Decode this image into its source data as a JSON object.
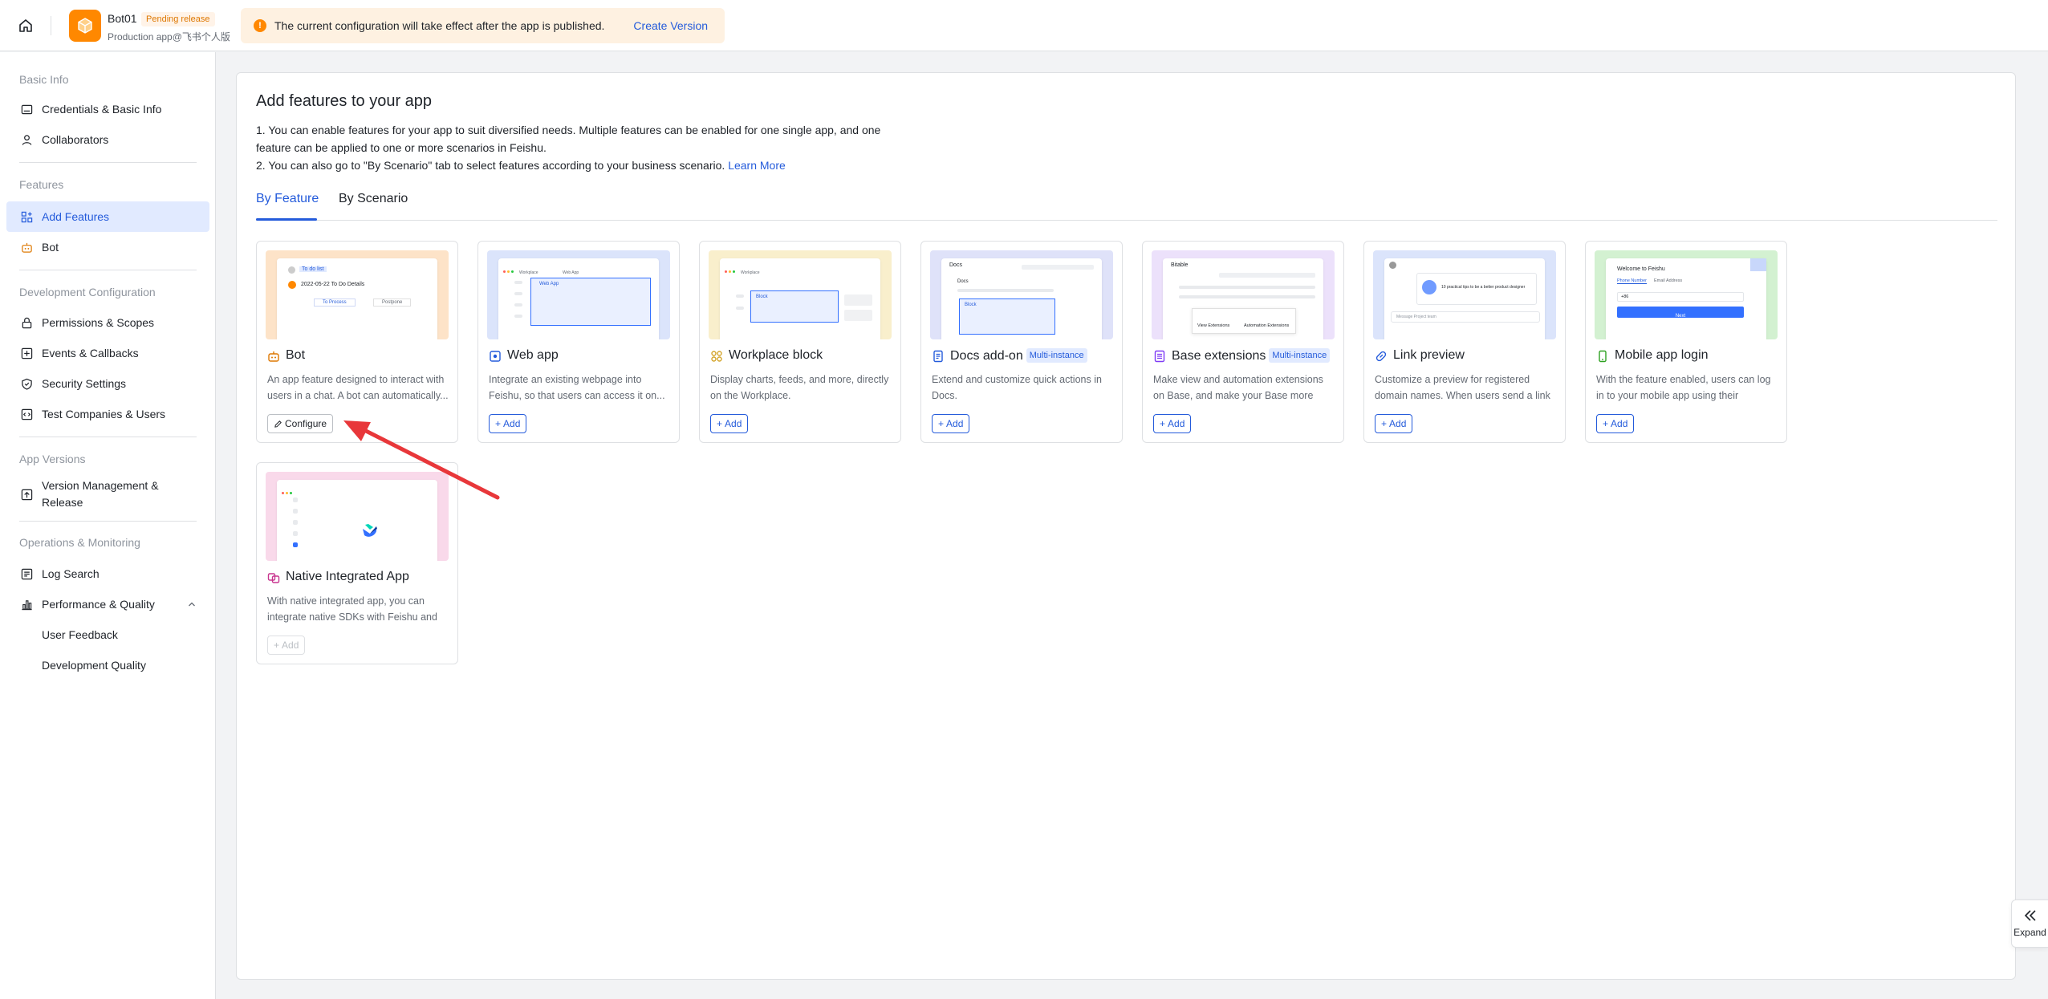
{
  "header": {
    "app_name": "Bot01",
    "status_badge": "Pending release",
    "app_subtitle": "Production app@飞书个人版",
    "notice_text": "The current configuration will take effect after the app is published.",
    "notice_link": "Create Version"
  },
  "sidebar": {
    "sections": [
      {
        "title": "Basic Info",
        "items": [
          {
            "label": "Credentials & Basic Info",
            "icon": "id-card-icon"
          },
          {
            "label": "Collaborators",
            "icon": "person-icon"
          }
        ]
      },
      {
        "title": "Features",
        "items": [
          {
            "label": "Add Features",
            "icon": "grid-plus-icon",
            "active": true
          },
          {
            "label": "Bot",
            "icon": "robot-icon"
          }
        ]
      },
      {
        "title": "Development Configuration",
        "items": [
          {
            "label": "Permissions & Scopes",
            "icon": "lock-icon"
          },
          {
            "label": "Events & Callbacks",
            "icon": "event-icon"
          },
          {
            "label": "Security Settings",
            "icon": "shield-icon"
          },
          {
            "label": "Test Companies & Users",
            "icon": "code-icon"
          }
        ]
      },
      {
        "title": "App Versions",
        "items": [
          {
            "label": "Version Management & Release",
            "icon": "upload-icon"
          }
        ]
      },
      {
        "title": "Operations & Monitoring",
        "items": [
          {
            "label": "Log Search",
            "icon": "log-icon"
          },
          {
            "label": "Performance & Quality",
            "icon": "chart-icon"
          },
          {
            "label": "User Feedback",
            "icon": ""
          },
          {
            "label": "Development Quality",
            "icon": ""
          }
        ]
      }
    ]
  },
  "main": {
    "title": "Add features to your app",
    "desc_line1": "1. You can enable features for your app to suit diversified needs. Multiple features can be enabled for one single app, and one feature can be applied to one or more scenarios in Feishu.",
    "desc_line2": "2. You can also go to \"By Scenario\" tab to select features according to your business scenario.",
    "learn_more": "Learn More",
    "tabs": [
      "By Feature",
      "By Scenario"
    ],
    "multi_instance_label": "Multi-instance",
    "cards": [
      {
        "title": "Bot",
        "desc": "An app feature designed to interact with users in a chat. A bot can automatically...",
        "button": "Configure",
        "icon": "robot-icon",
        "accent": "#ff8800",
        "thumb_bg": "#fde3c8",
        "thumb_text": [
          "To do list",
          "2022-05-22 To Do Details",
          "To Process",
          "Postpone"
        ]
      },
      {
        "title": "Web app",
        "desc": "Integrate an existing webpage into Feishu, so that users can access it on...",
        "button": "Add",
        "icon": "web-app-icon",
        "accent": "#3370ff",
        "thumb_bg": "#dbe4fb",
        "thumb_text": [
          "Workplace",
          "Web App",
          "Web App"
        ]
      },
      {
        "title": "Workplace block",
        "desc": "Display charts, feeds, and more, directly on the Workplace.",
        "button": "Add",
        "icon": "blocks-icon",
        "accent": "#d4a52c",
        "thumb_bg": "#f9efcc",
        "thumb_text": [
          "Workplace",
          "Block"
        ]
      },
      {
        "title": "Docs add-on",
        "desc": "Extend and customize quick actions in Docs.",
        "button": "Add",
        "icon": "doc-icon",
        "accent": "#3370ff",
        "thumb_bg": "#dfe2f9",
        "multi": true,
        "thumb_text": [
          "Docs",
          "Docs",
          "Block"
        ]
      },
      {
        "title": "Base extensions",
        "desc": "Make view and automation extensions on Base, and make your Base more powerful.",
        "button": "Add",
        "icon": "base-icon",
        "accent": "#7f3bf5",
        "thumb_bg": "#ece1fb",
        "multi": true,
        "thumb_text": [
          "Bitable",
          "View Extensions",
          "Automation Extensions"
        ]
      },
      {
        "title": "Link preview",
        "desc": "Customize a preview for registered domain names. When users send a link i...",
        "button": "Add",
        "icon": "link-icon",
        "accent": "#3370ff",
        "thumb_bg": "#dbe4fb",
        "thumb_text": [
          "10 practical tips to be a better product designer",
          "Message Project team"
        ]
      },
      {
        "title": "Mobile app login",
        "desc": "With the feature enabled, users can log in to your mobile app using their Feishu...",
        "button": "Add",
        "icon": "mobile-icon",
        "accent": "#34c724",
        "thumb_bg": "#d3f1d1",
        "thumb_text": [
          "Welcome to Feishu",
          "Phone Number",
          "Email Address",
          "+86",
          "Next"
        ]
      },
      {
        "title": "Native Integrated App",
        "desc": "With native integrated app, you can integrate native SDKs with Feishu and c...",
        "button": "Add",
        "icon": "native-app-icon",
        "accent": "#c8358f",
        "thumb_bg": "#f9d9ea",
        "disabled": true
      }
    ]
  },
  "expand": {
    "label": "Expand"
  }
}
